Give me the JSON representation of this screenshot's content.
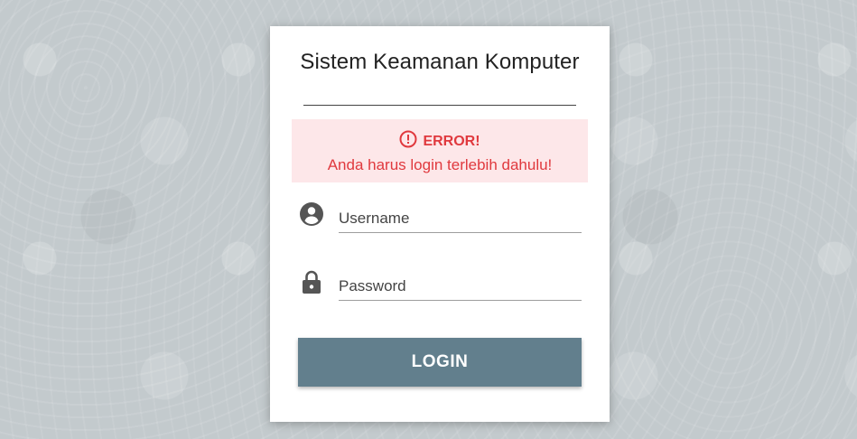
{
  "login_card": {
    "title": "Sistem Keamanan Komputer",
    "alert": {
      "heading": "ERROR!",
      "message": "Anda harus login terlebih dahulu!",
      "icon": "alert-circle-icon",
      "color": "#e0393e",
      "background": "#fde7e9"
    },
    "username": {
      "placeholder": "Username",
      "value": "",
      "icon": "account-circle-icon"
    },
    "password": {
      "placeholder": "Password",
      "value": "",
      "icon": "lock-icon"
    },
    "login_button": {
      "label": "LOGIN",
      "color": "#627f8d"
    }
  }
}
